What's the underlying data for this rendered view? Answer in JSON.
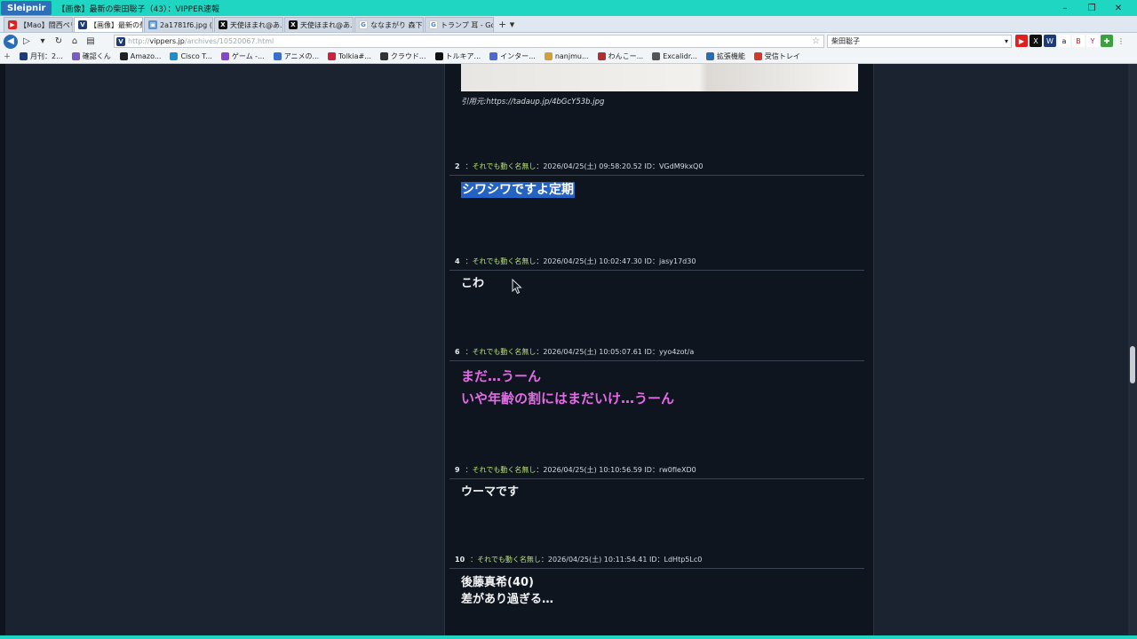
{
  "window": {
    "app_name": "Sleipnir",
    "title": "【画像】最新の柴田聡子（43）：VIPPER速報",
    "controls": [
      "–",
      "❐",
      "✕"
    ]
  },
  "tabs": [
    {
      "label": "【Mao】闘西ペリ...",
      "icon": "youtube-icon",
      "fav": "▶",
      "active": false
    },
    {
      "label": "【画像】最新の柴...",
      "icon": "vipper-icon",
      "fav": "V",
      "active": true
    },
    {
      "label": "2a1781f6.jpg (1...",
      "icon": "image-icon",
      "fav": "▣",
      "active": false
    },
    {
      "label": "天使ほまれ@あ...",
      "icon": "x-icon",
      "fav": "X",
      "active": false
    },
    {
      "label": "天使ほまれ@あ...",
      "icon": "x-icon",
      "fav": "X",
      "active": false
    },
    {
      "label": "ななまがり 森下 -...",
      "icon": "google-icon",
      "fav": "G",
      "active": false
    },
    {
      "label": "トランプ 耳 - Goo...",
      "icon": "google-icon",
      "fav": "G",
      "active": false
    }
  ],
  "tab_add": "+ ▾",
  "address": {
    "scheme": "http://",
    "host": "vippers.jp",
    "path": "/archives/10520067.html",
    "search_value": "柴田聡子"
  },
  "bookmarks": [
    {
      "label": "月刊：2...",
      "color": "#1d3b78"
    },
    {
      "label": "確認くん",
      "color": "#7a5cc0"
    },
    {
      "label": "Amazo...",
      "color": "#222222"
    },
    {
      "label": "Cisco T...",
      "color": "#1a8fd0"
    },
    {
      "label": "ゲーム -...",
      "color": "#8844cc"
    },
    {
      "label": "アニメの...",
      "color": "#3a6fd0"
    },
    {
      "label": "Tolkia#...",
      "color": "#d02040"
    },
    {
      "label": "クラウド...",
      "color": "#333333"
    },
    {
      "label": "トルキア...",
      "color": "#111111"
    },
    {
      "label": "インター...",
      "color": "#4a6cd0"
    },
    {
      "label": "nanjmu...",
      "color": "#d0a040"
    },
    {
      "label": "わんこー...",
      "color": "#b03030"
    },
    {
      "label": "Excalidr...",
      "color": "#555555"
    },
    {
      "label": "拡張機能",
      "color": "#2a6db5"
    },
    {
      "label": "受信トレイ",
      "color": "#d03a2a"
    }
  ],
  "article": {
    "image_source": "引用元:https://tadaup.jp/4bGcY53b.jpg",
    "posts": [
      {
        "num": "2",
        "name": "：それでも動く名無し",
        "meta": "：2026/04/25(土) 09:58:20.52 ID：VGdM9kxQ0",
        "lines": [
          "シワシワですよ定期"
        ],
        "selected": true,
        "style": "normal"
      },
      {
        "num": "4",
        "name": "：それでも動く名無し",
        "meta": "：2026/04/25(土) 10:02:47.30 ID：jasy17d30",
        "lines": [
          "こわ"
        ],
        "selected": false,
        "style": "normal"
      },
      {
        "num": "6",
        "name": "：それでも動く名無し",
        "meta": "：2026/04/25(土) 10:05:07.61 ID：yyo4zot/a",
        "lines": [
          "まだ…うーん",
          "いや年齢の割にはまだいけ…うーん"
        ],
        "selected": false,
        "style": "big"
      },
      {
        "num": "9",
        "name": "：それでも動く名無し",
        "meta": "：2026/04/25(土) 10:10:56.59 ID：rw0fIeXD0",
        "lines": [
          "ウーマです"
        ],
        "selected": false,
        "style": "normal"
      },
      {
        "num": "10",
        "name": "：それでも動く名無し",
        "meta": "：2026/04/25(土) 10:11:54.41 ID：LdHtp5Lc0",
        "lines": [
          "後藤真希(40)",
          "差があり過ぎる…"
        ],
        "selected": false,
        "style": "normal"
      }
    ]
  }
}
